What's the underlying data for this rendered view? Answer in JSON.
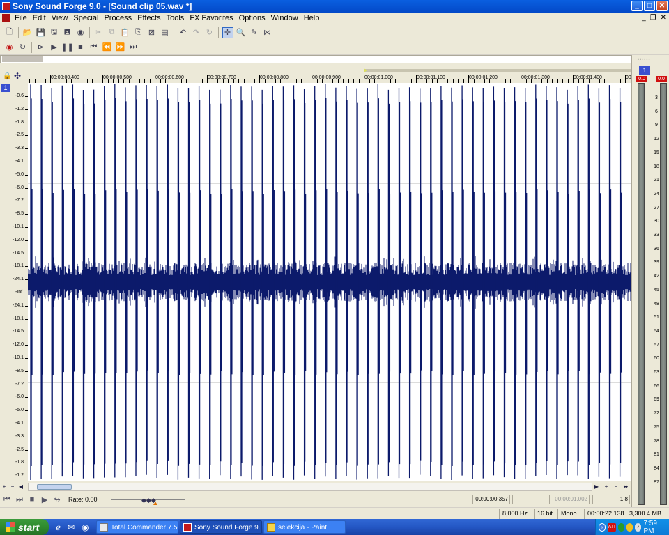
{
  "window": {
    "title": "Sony Sound Forge 9.0 - [Sound clip 05.wav *]",
    "minimize_label": "_",
    "maximize_label": "□",
    "close_label": "✕"
  },
  "menu": {
    "items": [
      "File",
      "Edit",
      "View",
      "Special",
      "Process",
      "Effects",
      "Tools",
      "FX Favorites",
      "Options",
      "Window",
      "Help"
    ],
    "mdi_minimize": "_",
    "mdi_restore": "❐",
    "mdi_close": "✕"
  },
  "toolbar1": {
    "icons": [
      "new-file-icon",
      "open-folder-icon",
      "save-icon",
      "save-as-icon",
      "save-all-icon",
      "render-icon",
      "cut-icon",
      "copy-icon",
      "paste-icon",
      "paste-mix-icon",
      "crossfade-icon",
      "trim-icon",
      "undo-icon",
      "redo-icon",
      "repeat-icon",
      "edit-tool-icon",
      "magnify-tool-icon",
      "pencil-tool-icon",
      "envelope-tool-icon"
    ]
  },
  "toolbar2": {
    "icons": [
      "record-icon",
      "loop-icon",
      "play-all-icon",
      "play-icon",
      "pause-icon",
      "stop-icon",
      "go-to-start-icon",
      "rewind-icon",
      "forward-icon",
      "go-to-end-icon"
    ]
  },
  "ruler": {
    "labels": [
      "00:00:00.400",
      "00:00:00.500",
      "00:00:00.600",
      "00:00:00.700",
      "00:00:00.800",
      "00:00:00.900",
      "00:00:01.000",
      "00:00:01.100",
      "00:00:01.200",
      "00:00:01.300",
      "00:00:01.400",
      "00:"
    ]
  },
  "channel": {
    "number": "1"
  },
  "amplitude": {
    "labels": [
      "-0.6",
      "-1.2",
      "-1.8",
      "-2.5",
      "-3.3",
      "-4.1",
      "-5.0",
      "-6.0",
      "-7.2",
      "-8.5",
      "-10.1",
      "-12.0",
      "-14.5",
      "-18.1",
      "-24.1",
      "-Inf.",
      "-24.1",
      "-18.1",
      "-14.5",
      "-12.0",
      "-10.1",
      "-8.5",
      "-7.2",
      "-6.0",
      "-5.0",
      "-4.1",
      "-3.3",
      "-2.5",
      "-1.8",
      "-1.2",
      "-0.6"
    ]
  },
  "waveform": {
    "color": "#0c1a6b",
    "clicks": 57,
    "noise_level_db": "-24.1"
  },
  "transport": {
    "rate_label": "Rate: 0.00",
    "position": "00:00:00.357",
    "selection_start": "",
    "selection_length": "00:00:01.002",
    "zoom": "1:8"
  },
  "status": {
    "sample_rate": "8,000 Hz",
    "bit_depth": "16 bit",
    "channels": "Mono",
    "length": "00:00:22.138",
    "disk_space": "3,300.4 MB"
  },
  "meter": {
    "grip": "••••••",
    "channel": "1",
    "peak_left": "0.0",
    "peak_right": "0.0",
    "scale": [
      "3",
      "6",
      "9",
      "12",
      "15",
      "18",
      "21",
      "24",
      "27",
      "30",
      "33",
      "36",
      "39",
      "42",
      "45",
      "48",
      "51",
      "54",
      "57",
      "60",
      "63",
      "66",
      "69",
      "72",
      "75",
      "78",
      "81",
      "84",
      "87"
    ]
  },
  "taskbar": {
    "start_label": "start",
    "tasks": [
      {
        "label": "Total Commander 7.5...",
        "active": false
      },
      {
        "label": "Sony Sound Forge 9....",
        "active": true
      },
      {
        "label": "selekcija - Paint",
        "active": false
      }
    ],
    "tray_ati": "ATI",
    "clock": "7:59 PM"
  }
}
